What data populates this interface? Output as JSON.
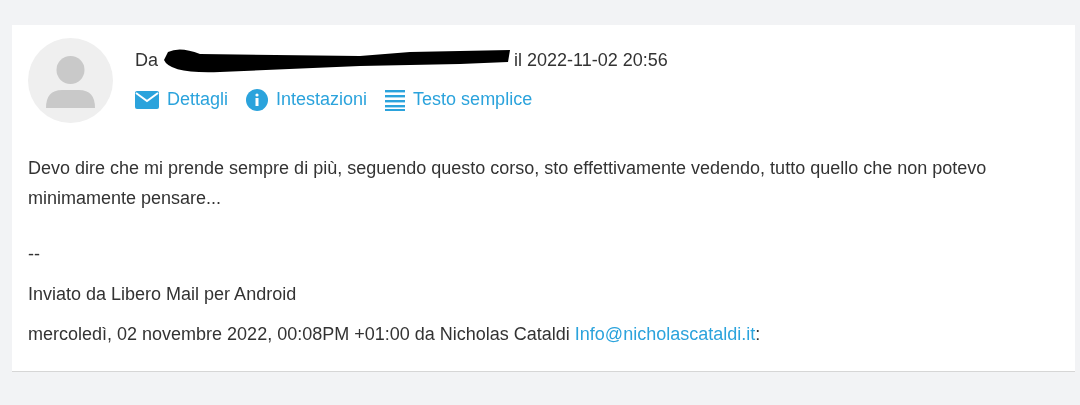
{
  "header": {
    "from_label": "Da",
    "date_text": "il 2022-11-02 20:56"
  },
  "actions": [
    {
      "kind": "details",
      "label": "Dettagli"
    },
    {
      "kind": "headers",
      "label": "Intestazioni"
    },
    {
      "kind": "plain",
      "label": "Testo semplice"
    }
  ],
  "body": {
    "message": "Devo dire che mi prende sempre di più, seguendo questo corso, sto effettivamente vedendo, tutto quello che non potevo minimamente pensare...",
    "separator": "--",
    "signature": "Inviato da Libero Mail per Android",
    "quote_intro": "mercoledì, 02 novembre 2022, 00:08PM +01:00 da Nicholas Cataldi",
    "quote_email": "Info@nicholascataldi.it",
    "quote_suffix": ":"
  }
}
